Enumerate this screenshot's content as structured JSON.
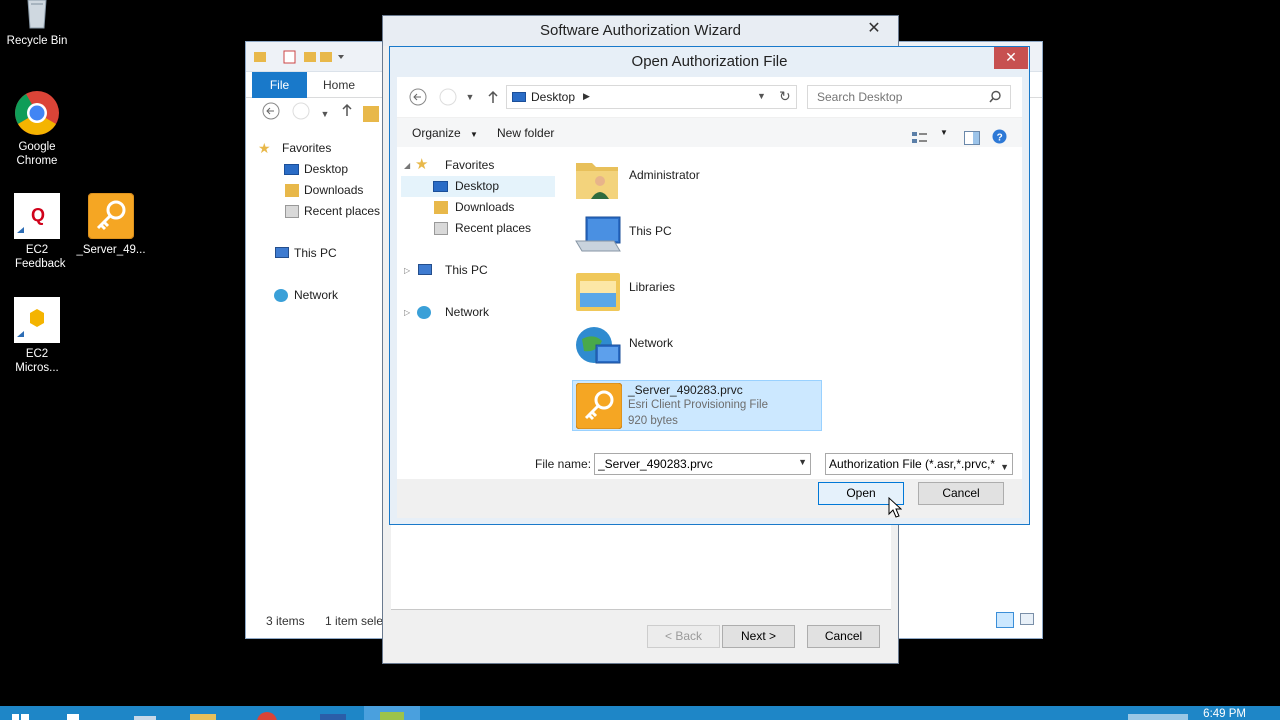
{
  "desktop": {
    "icons": [
      {
        "label": "Recycle Bin"
      },
      {
        "label": "Google Chrome"
      },
      {
        "label": "EC2 Feedback"
      },
      {
        "label": "_Server_49..."
      },
      {
        "label": "EC2 Micros..."
      }
    ]
  },
  "explorer": {
    "tabs": {
      "file": "File",
      "home": "Home"
    },
    "nav": {
      "favorites": "Favorites",
      "desktop": "Desktop",
      "downloads": "Downloads",
      "recent": "Recent places",
      "this_pc": "This PC",
      "network": "Network"
    },
    "status": {
      "items": "3 items",
      "selected": "1 item sele"
    }
  },
  "wizard": {
    "title": "Software Authorization Wizard",
    "close": "✕",
    "back": "< Back",
    "next": "Next >",
    "cancel": "Cancel"
  },
  "dialog": {
    "title": "Open Authorization File",
    "close": "✕",
    "address": "Desktop",
    "search_placeholder": "Search Desktop",
    "organize": "Organize",
    "new_folder": "New folder",
    "tree": {
      "favorites": "Favorites",
      "desktop": "Desktop",
      "downloads": "Downloads",
      "recent": "Recent places",
      "this_pc": "This PC",
      "network": "Network"
    },
    "items": [
      {
        "name": "Administrator"
      },
      {
        "name": "This PC"
      },
      {
        "name": "Libraries"
      },
      {
        "name": "Network"
      }
    ],
    "file": {
      "name": "_Server_490283.prvc",
      "type": "Esri Client Provisioning File",
      "size": "920 bytes"
    },
    "file_name_label": "File name:",
    "file_name_value": "_Server_490283.prvc",
    "file_type": "Authorization File (*.asr,*.prvc,*",
    "open": "Open",
    "cancel": "Cancel"
  },
  "taskbar": {
    "clock": "6:49 PM"
  },
  "colors": {
    "accent": "#1979ca",
    "selection": "#cce8ff",
    "taskbar": "#1e86c7"
  }
}
